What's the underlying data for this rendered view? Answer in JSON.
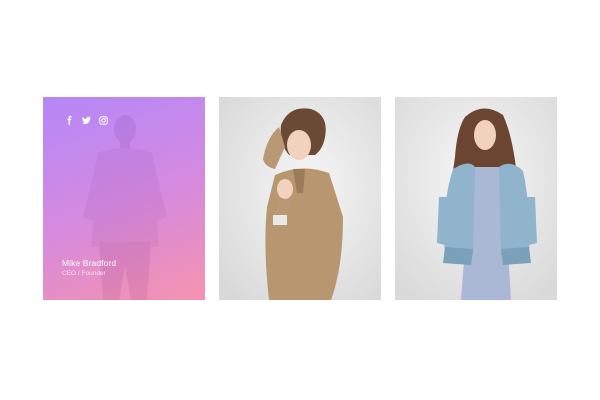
{
  "team": {
    "members": [
      {
        "name": "Mike Bradford",
        "role": "CEO / Founder",
        "socials": [
          "facebook-icon",
          "twitter-icon",
          "instagram-icon"
        ],
        "overlay_colors": [
          "#b080fa",
          "#f78caa"
        ]
      },
      {
        "name": "",
        "role": ""
      },
      {
        "name": "",
        "role": ""
      }
    ]
  }
}
